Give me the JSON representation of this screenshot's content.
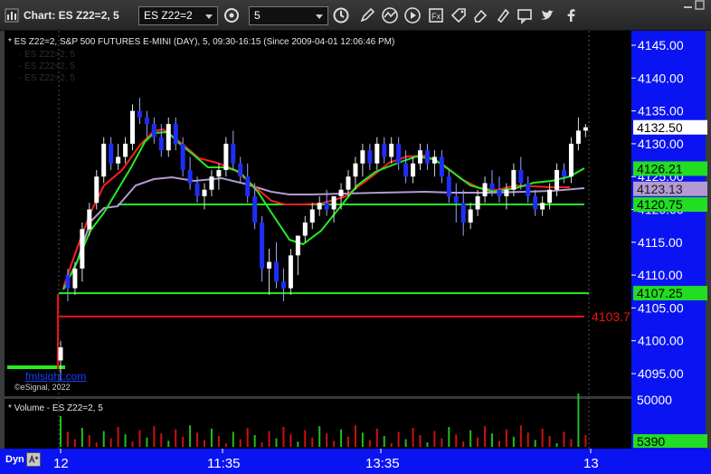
{
  "window": {
    "title": "Chart: ES Z22=2, 5",
    "symbol_value": "ES Z22=2",
    "interval_value": "5"
  },
  "toolbar": {
    "icons": [
      "cycle-icon",
      "clock-icon",
      "pencil-icon",
      "studies-icon",
      "play-icon",
      "formula-icon",
      "tag-icon",
      "eraser-icon",
      "comment-icon",
      "twitter-icon",
      "facebook-icon"
    ]
  },
  "chart": {
    "header": "* ES Z22=2, S&P 500 FUTURES E-MINI (DAY), 5, 09:30-16:15 (Since 2009-04-01 12:06:46 PM)",
    "legend_ghost": [
      "- ES Z22=2, 5",
      "- ES Z22=2, 5",
      "- ES Z22=2, 5"
    ],
    "watermark_site": "fmlsight.com",
    "watermark_copyright": "©eSignal, 2022",
    "price_axis": [
      "4145.00",
      "4140.00",
      "4135.00",
      "4130.00",
      "4125.00",
      "4120.00",
      "4115.00",
      "4110.00",
      "4105.00",
      "4100.00",
      "4095.00"
    ],
    "price_tags": [
      {
        "label": "4132.50",
        "bg": "#ffffff",
        "fg": "#000000"
      },
      {
        "label": "4126.21",
        "bg": "#22dd22",
        "fg": "#000000"
      },
      {
        "label": "4123.13",
        "bg": "#b49ad2",
        "fg": "#1a1a1a"
      },
      {
        "label": "4120.75",
        "bg": "#22dd22",
        "fg": "#000000"
      },
      {
        "label": "4107.25",
        "bg": "#22dd22",
        "fg": "#000000"
      }
    ],
    "red_level_label": "4103.7",
    "time_axis": [
      "12",
      "11:35",
      "13:35",
      "13"
    ],
    "colors": {
      "up": "#ffffff",
      "down": "#1f2ef5",
      "ema_fast": "#ff2020",
      "ema_green": "#22ee22",
      "ma_slow": "#b49ad2",
      "level_green": "#22ee22",
      "level_red": "#ee1111",
      "axis_bg": "#0a14f2"
    }
  },
  "volume": {
    "header": "* Volume - ES Z22=2, 5",
    "axis_label": "50000",
    "tag": "5390",
    "colors": {
      "up": "#cc1111",
      "down": "#22bb22"
    }
  },
  "footer": {
    "dyn_label": "Dyn"
  }
}
